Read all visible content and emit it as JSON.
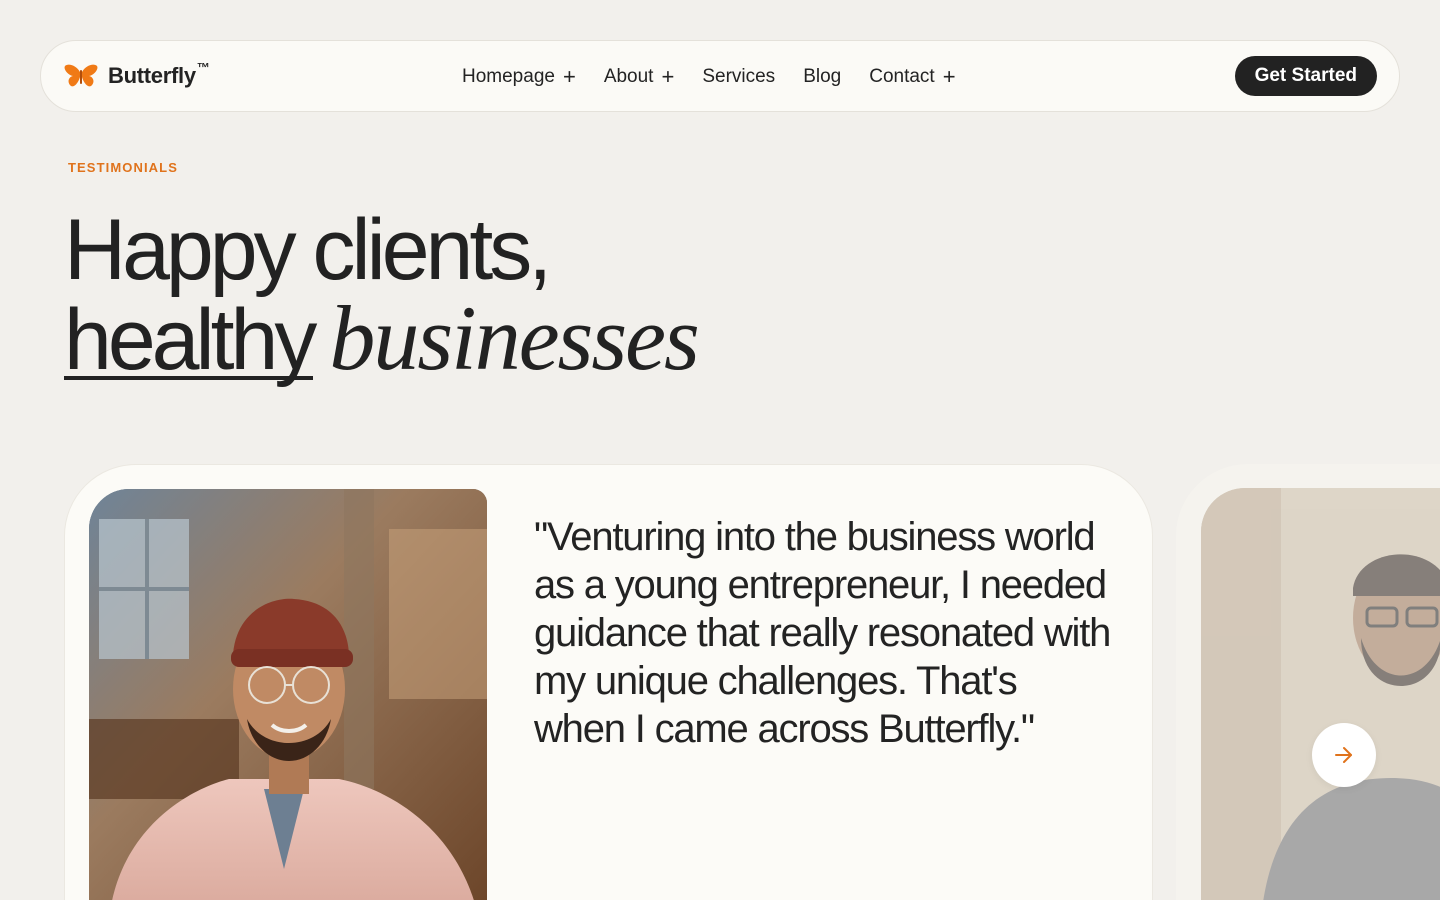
{
  "brand": {
    "name": "Butterfly",
    "tm": "™",
    "accent_color": "#f07a16"
  },
  "nav": {
    "items": [
      {
        "label": "Homepage",
        "has_submenu": true,
        "submenu_icon": "+"
      },
      {
        "label": "About",
        "has_submenu": true,
        "submenu_icon": "+"
      },
      {
        "label": "Services",
        "has_submenu": false
      },
      {
        "label": "Blog",
        "has_submenu": false
      },
      {
        "label": "Contact",
        "has_submenu": true,
        "submenu_icon": "+"
      }
    ],
    "cta_label": "Get Started"
  },
  "hero": {
    "eyebrow": "TESTIMONIALS",
    "headline_line1": "Happy clients,",
    "headline_line2_underlined": "healthy",
    "headline_line2_italic": "businesses"
  },
  "testimonial": {
    "quote": "\"Venturing into the business world as a young entrepreneur, I needed guidance that really resonated with my unique challenges. That's when I came across Butterfly.\"",
    "photo_icon": "person-photo"
  },
  "carousel": {
    "next_icon": "arrow-right-icon",
    "arrow_color": "#e0731c"
  },
  "colors": {
    "background": "#f2f0ec",
    "card": "#fcfbf7",
    "text": "#232323",
    "accent": "#e0731c",
    "cta_bg": "#222222"
  }
}
